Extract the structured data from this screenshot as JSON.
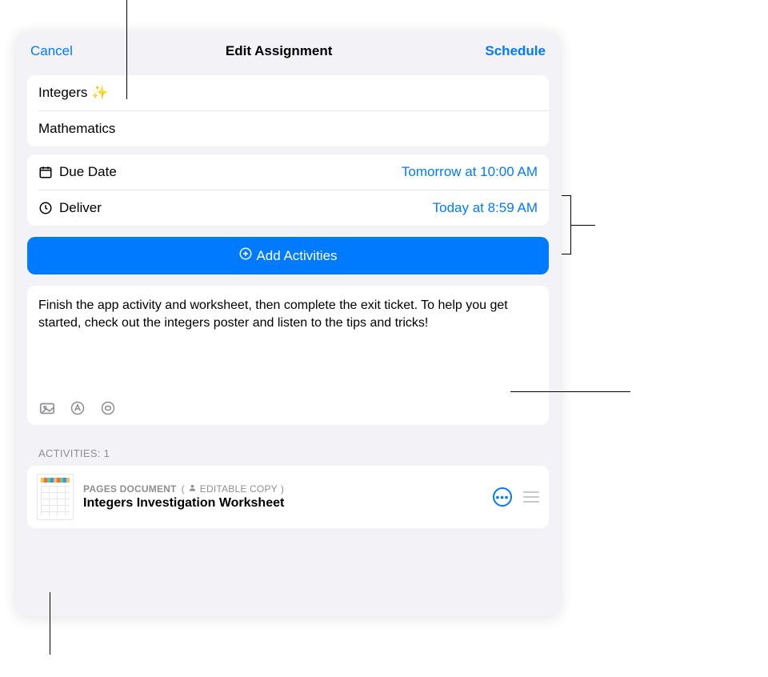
{
  "header": {
    "cancel": "Cancel",
    "title": "Edit Assignment",
    "schedule": "Schedule"
  },
  "assignment": {
    "name": "Integers ✨",
    "class": "Mathematics"
  },
  "dates": {
    "due_label": "Due Date",
    "due_value": "Tomorrow at 10:00 AM",
    "deliver_label": "Deliver",
    "deliver_value": "Today at 8:59 AM"
  },
  "actions": {
    "add_activities": "Add Activities"
  },
  "description": "Finish the app activity and worksheet, then complete the exit ticket. To help you get started, check out the integers poster and listen to the tips and tricks!",
  "activities": {
    "header": "ACTIVITIES: 1",
    "items": [
      {
        "type": "PAGES DOCUMENT",
        "badge": "EDITABLE COPY",
        "title": "Integers Investigation Worksheet"
      }
    ]
  }
}
